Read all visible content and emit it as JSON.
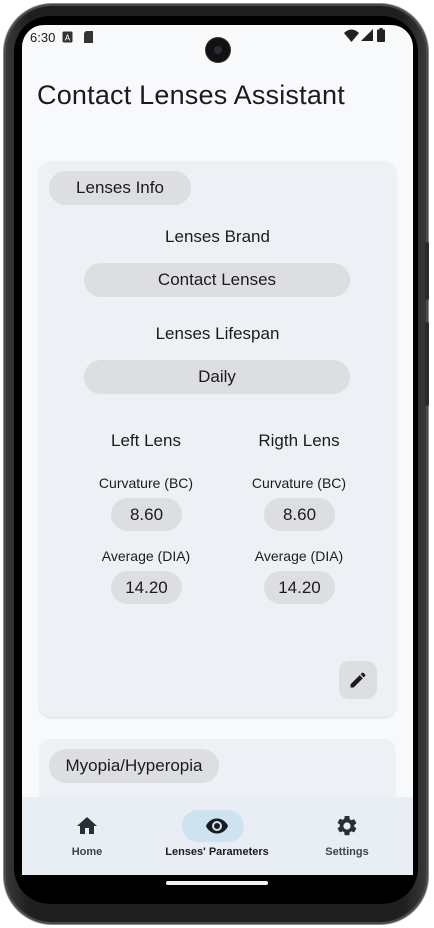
{
  "status_bar": {
    "time": "6:30"
  },
  "app": {
    "title": "Contact Lenses Assistant"
  },
  "lenses_info": {
    "section_label": "Lenses Info",
    "brand_label": "Lenses Brand",
    "brand_value": "Contact Lenses",
    "lifespan_label": "Lenses Lifespan",
    "lifespan_value": "Daily",
    "left": {
      "title": "Left Lens",
      "bc_label": "Curvature (BC)",
      "bc_value": "8.60",
      "dia_label": "Average (DIA)",
      "dia_value": "14.20"
    },
    "right": {
      "title": "Rigth Lens",
      "bc_label": "Curvature (BC)",
      "bc_value": "8.60",
      "dia_label": "Average (DIA)",
      "dia_value": "14.20"
    },
    "edit_icon": "pencil-icon"
  },
  "myopia": {
    "section_label": "Myopia/Hyperopia"
  },
  "nav": {
    "items": [
      {
        "label": "Home",
        "icon": "home-icon",
        "active": false
      },
      {
        "label": "Lenses' Parameters",
        "icon": "eye-icon",
        "active": true
      },
      {
        "label": "Settings",
        "icon": "gear-icon",
        "active": false
      }
    ]
  },
  "colors": {
    "card": "#edf1f5",
    "chip": "#dcdee1",
    "nav_bg": "#e8eef3",
    "nav_active": "#cde3f0"
  }
}
